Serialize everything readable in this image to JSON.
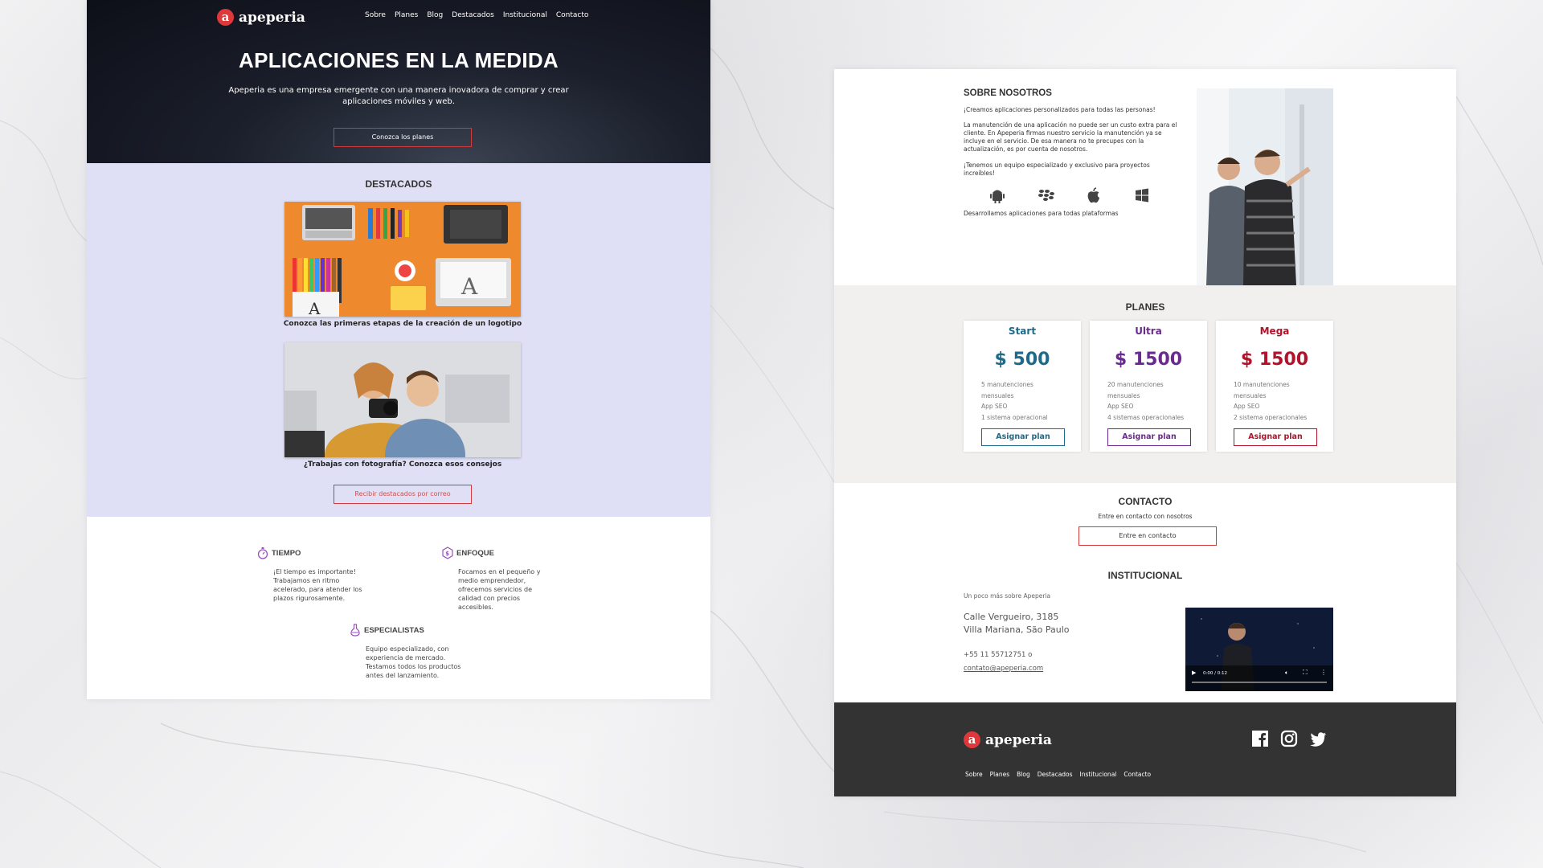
{
  "left_page": {
    "header": {
      "logo_text": "apeperia",
      "logo_mark": "a",
      "nav": [
        "Sobre",
        "Planes",
        "Blog",
        "Destacados",
        "Institucional",
        "Contacto"
      ]
    },
    "hero": {
      "title": "APLICACIONES EN LA MEDIDA",
      "subtitle": "Apeperia es una empresa emergente con una manera inovadora de comprar y crear aplicaciones móviles y web.",
      "cta": "Conozca los planes"
    },
    "destacados": {
      "title": "DESTACADOS",
      "items": [
        {
          "caption": "Conozca las primeras etapas de la creación de un logotipo"
        },
        {
          "caption": "¿Trabajas con fotografía? Conozca esos consejos"
        }
      ],
      "cta": "Recibir destacados por correo"
    },
    "features": [
      {
        "title": "TIEMPO",
        "text": "¡El tiempo es importante! Trabajamos en ritmo acelerado, para atender los plazos rigurosamente.",
        "icon": "stopwatch-icon"
      },
      {
        "title": "ENFOQUE",
        "text": "Focamos en el pequeño y medio emprendedor, ofrecemos servicios de calidad con precios accesibles.",
        "icon": "money-badge-icon"
      },
      {
        "title": "ESPECIALISTAS",
        "text": "Equipo especializado, con experiencia de mercado. Testamos todos los productos antes del lanzamiento.",
        "icon": "flask-icon"
      }
    ]
  },
  "right_page": {
    "about": {
      "title": "SOBRE NOSOTROS",
      "p1": "¡Creamos aplicaciones personalizados para todas las personas!",
      "p2": "La manutención de una aplicación no puede ser un custo extra para el cliente. En Apeperia firmas nuestro servicio la manutención ya se incluye en el servicio. De esa manera no te precupes con la actualización, es por cuenta de nosotros.",
      "p3": "¡Tenemos un equipo especializado y exclusivo para proyectos increíbles!",
      "platforms_caption": "Desarrollamos aplicaciones para todas plataformas",
      "platform_icons": [
        "android-icon",
        "blackberry-icon",
        "apple-icon",
        "windows-icon"
      ]
    },
    "plans": {
      "title": "PLANES",
      "cards": [
        {
          "name": "Start",
          "price": "$ 500",
          "features": [
            "5 manutenciones",
            "mensuales",
            "App SEO",
            "1 sistema operacional"
          ],
          "button": "Asignar plan",
          "color": "#1d6a8a"
        },
        {
          "name": "Ultra",
          "price": "$ 1500",
          "features": [
            "20 manutenciones",
            "mensuales",
            "App SEO",
            "4 sistemas operacionales"
          ],
          "button": "Asignar plan",
          "color": "#6b2a8f"
        },
        {
          "name": "Mega",
          "price": "$ 1500",
          "features": [
            "10 manutenciones",
            "mensuales",
            "App SEO",
            "2 sistema operacionales"
          ],
          "button": "Asignar plan",
          "color": "#b3122b"
        }
      ]
    },
    "contact": {
      "title": "CONTACTO",
      "subtitle": "Entre en contacto con nosotros",
      "button": "Entre en contacto"
    },
    "institutional": {
      "title": "INSTITUCIONAL",
      "subtitle": "Un poco más sobre Apeperia",
      "address1": "Calle Vergueiro, 3185",
      "address2": "Villa Mariana, São Paulo",
      "phone": "+55 11 55712751 o",
      "email": "contato@apeperia.com",
      "video_time": "0:00 / 0:12"
    },
    "footer": {
      "logo_text": "apeperia",
      "logo_mark": "a",
      "nav": [
        "Sobre",
        "Planes",
        "Blog",
        "Destacados",
        "Institucional",
        "Contacto"
      ],
      "social_icons": [
        "facebook-icon",
        "instagram-icon",
        "twitter-icon"
      ]
    }
  },
  "colors": {
    "accent": "#e0373a",
    "destacados_bg": "#dfe0f5",
    "plans_bg": "#f1f0ee",
    "footer_bg": "#333333"
  }
}
